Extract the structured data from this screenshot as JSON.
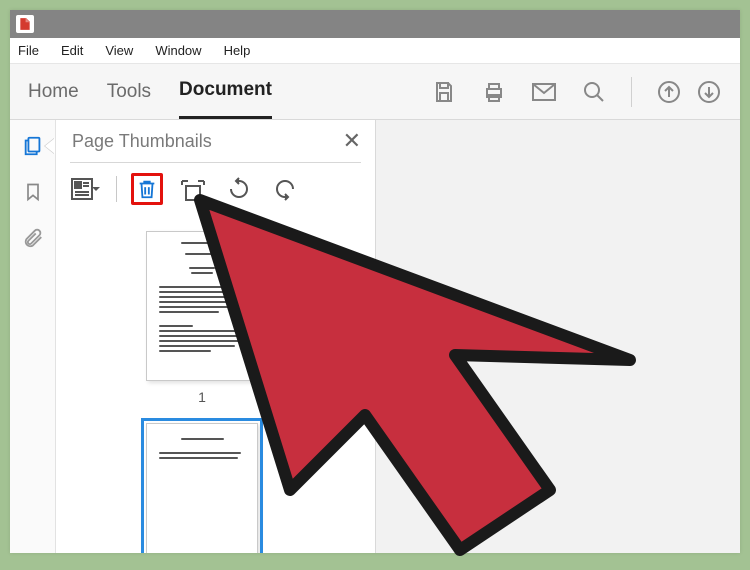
{
  "menubar": {
    "file": "File",
    "edit": "Edit",
    "view": "View",
    "window": "Window",
    "help": "Help"
  },
  "toolbar": {
    "home": "Home",
    "tools": "Tools",
    "document": "Document"
  },
  "panel": {
    "title": "Page Thumbnails",
    "close_glyph": "✕"
  },
  "thumbnails": {
    "page1_label": "1"
  },
  "icons": {
    "save": "save-icon",
    "print": "print-icon",
    "mail": "mail-icon",
    "search": "search-icon",
    "upload": "upload-icon",
    "download": "download-icon",
    "pages": "pages-icon",
    "bookmark": "bookmark-icon",
    "attach": "paperclip-icon",
    "options": "options-icon",
    "trash": "trash-icon",
    "insert": "insert-page-icon",
    "rotate_ccw": "rotate-ccw-icon",
    "rotate_cw": "rotate-cw-icon"
  }
}
